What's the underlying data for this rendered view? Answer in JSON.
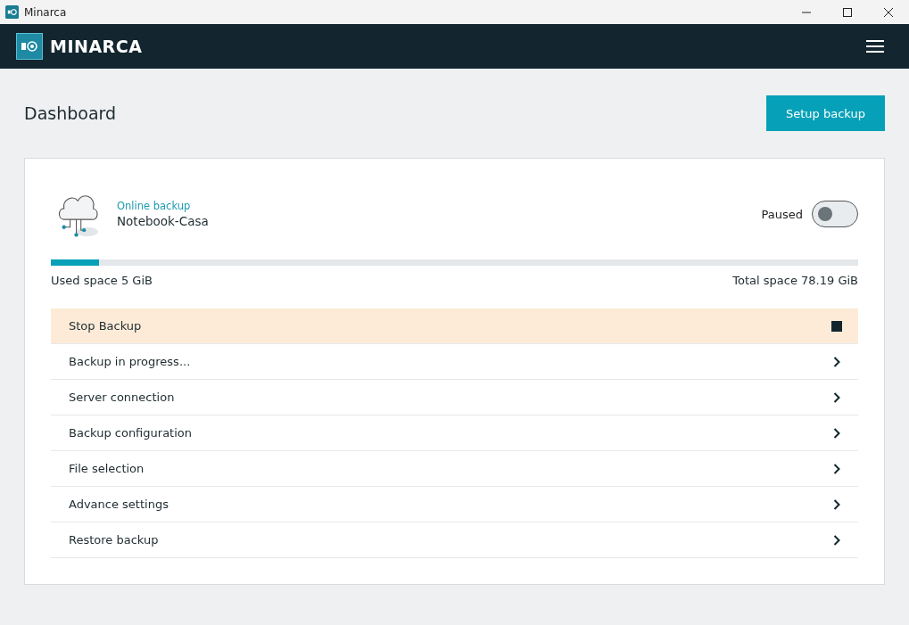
{
  "window": {
    "title": "Minarca"
  },
  "header": {
    "brand": "MINARCA"
  },
  "page": {
    "title": "Dashboard",
    "action": "Setup backup"
  },
  "backup": {
    "type": "Online backup",
    "name": "Notebook-Casa",
    "status": "Paused",
    "on": false,
    "level": 0.06,
    "used": "Used space 5 GiB",
    "total": "Total space 78.19 GiB"
  },
  "menu": [
    {
      "label": "Stop Backup",
      "kind": "action"
    },
    {
      "label": "Backup in progress...",
      "kind": "link"
    },
    {
      "label": "Server connection",
      "kind": "link"
    },
    {
      "label": "Backup configuration",
      "kind": "link"
    },
    {
      "label": "File selection",
      "kind": "link"
    },
    {
      "label": "Advance settings",
      "kind": "link"
    },
    {
      "label": "Restore backup",
      "kind": "link"
    }
  ]
}
